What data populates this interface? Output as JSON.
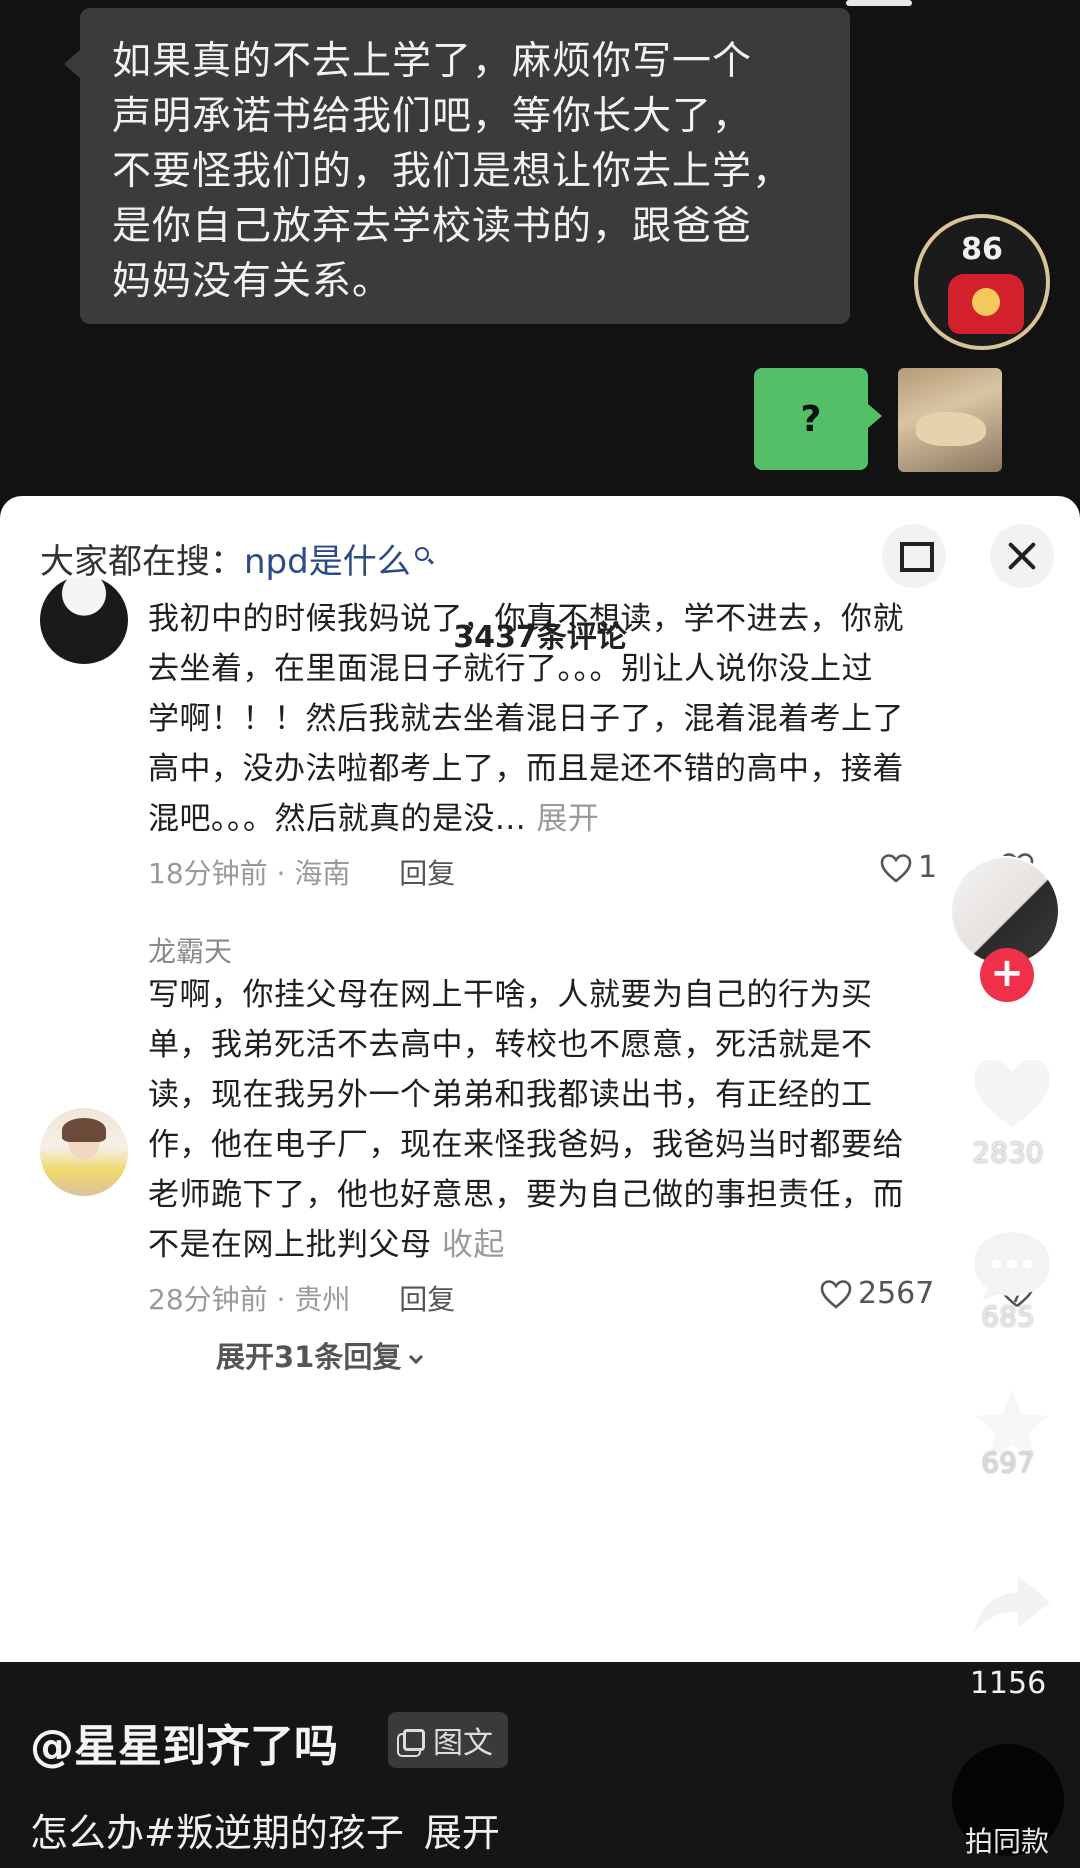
{
  "chat": {
    "message": "如果真的不去上学了，麻烦你写一个声明承诺书给我们吧，等你长大了，不要怪我们的，我们是想让你去上学，是你自己放弃去学校读书的，跟爸爸妈妈没有关系。",
    "message_lines": [
      "如果真的不去上学了，麻烦你写一个",
      "声明承诺书给我们吧，等你长大了，",
      "不要怪我们的，我们是想让你去上学，",
      "是你自己放弃去学校读书的，跟爸爸",
      "妈妈没有关系。"
    ],
    "red_packet_count": "86",
    "reply_bubble": "?"
  },
  "sheet": {
    "search_prefix": "大家都在搜：",
    "search_keyword": "npd是什么",
    "comment_count": "3437条评论"
  },
  "comments": [
    {
      "user": "",
      "text_lines": [
        "我初中的时候我妈说了，你真不想读，学不进去，你就",
        "去坐着，在里面混日子就行了。。。别让人说你没上过",
        "学啊！！！然后我就去坐着混日子了，混着混着考上了",
        "高中，没办法啦都考上了，而且是还不错的高中，接着",
        "混吧。。。然后就真的是没..."
      ],
      "more_label": "展开",
      "time_location": "18分钟前 · 海南",
      "reply_label": "回复",
      "likes": "1"
    },
    {
      "user": "龙霸天",
      "text_lines": [
        "写啊，你挂父母在网上干啥，人就要为自己的行为买",
        "单，我弟死活不去高中，转校也不愿意，死活就是不",
        "读，现在我另外一个弟弟和我都读出书，有正经的工",
        "作，他在电子厂，现在来怪我爸妈，我爸妈当时都要给",
        "老师跪下了，他也好意思，要为自己做的事担责任，而",
        "不是在网上批判父母"
      ],
      "more_label": "收起",
      "time_location": "28分钟前 · 贵州",
      "reply_label": "回复",
      "likes": "2567",
      "expand_replies": "展开31条回复"
    }
  ],
  "side_actions": {
    "like_count": "2830",
    "comment_count": "685",
    "favorite_count": "697",
    "share_count": "1156"
  },
  "bottom": {
    "author": "@星星到齐了吗",
    "tag": "图文",
    "caption": "怎么办#叛逆期的孩子",
    "expand": "展开",
    "shoot_label": "拍同款"
  },
  "colors": {
    "accent_red": "#f0304b",
    "chat_green": "#53c069",
    "search_keyword_blue": "#2b4a86"
  }
}
